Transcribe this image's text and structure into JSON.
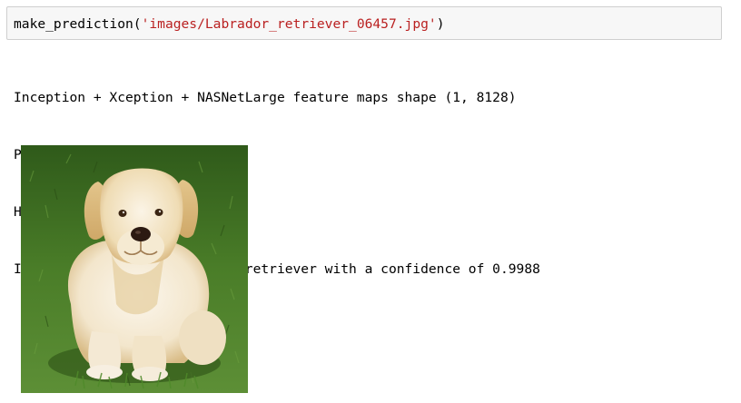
{
  "input_cell": {
    "func_name": "make_prediction",
    "open_paren": "(",
    "arg_string": "'images/Labrador_retriever_06457.jpg'",
    "close_paren": ")"
  },
  "output": {
    "lines": [
      "Inception + Xception + NASNetLarge feature maps shape (1, 8128)",
      "Predicted label index: 95",
      "Hellow Dog!",
      "I predicted you are Labrador retriever with a confidence of 0.9988"
    ]
  },
  "image": {
    "subject": "labrador-retriever-dog-photo",
    "colors": {
      "grass_dark": "#2f5a1a",
      "grass_light": "#5d8f36",
      "fur_light": "#f6efe2",
      "fur_cream": "#e9d3a4",
      "fur_shadow": "#cfae78"
    }
  }
}
